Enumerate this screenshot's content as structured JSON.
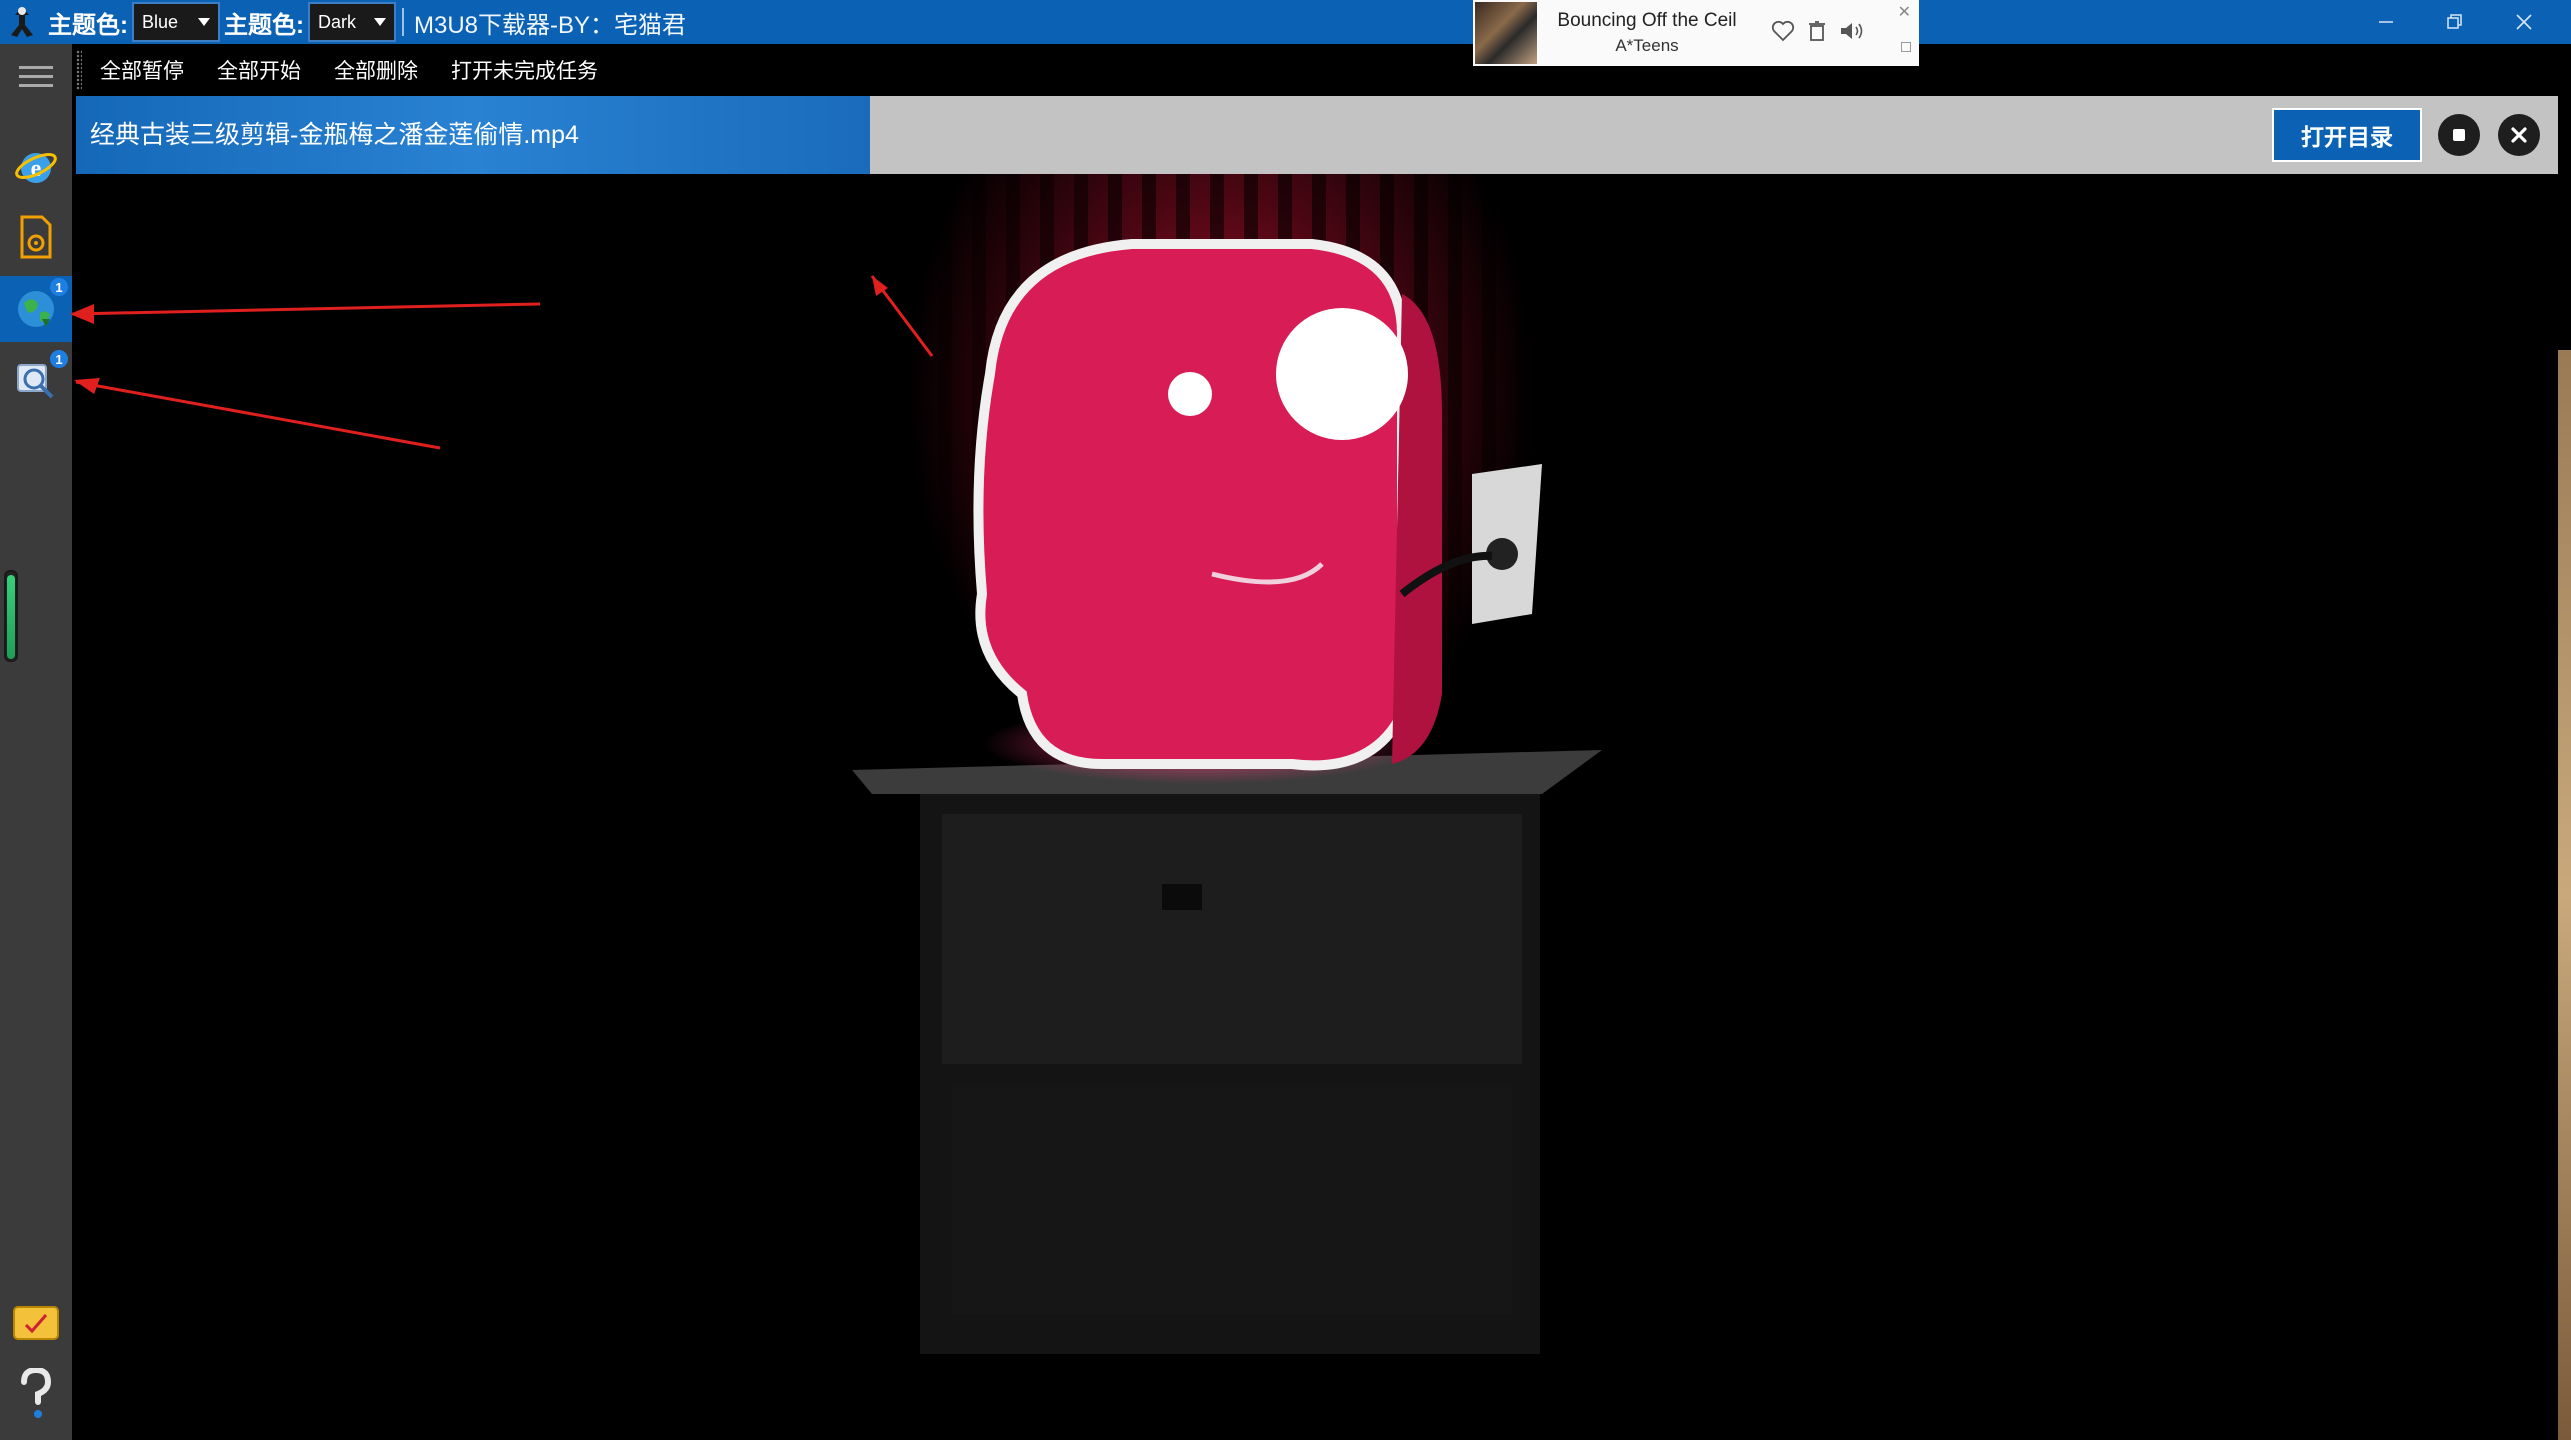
{
  "titlebar": {
    "theme_label_1": "主题色:",
    "theme_value_1": "Blue",
    "theme_label_2": "主题色:",
    "theme_value_2": "Dark",
    "app_title": "M3U8下载器-BY：宅猫君"
  },
  "player": {
    "song_title": "Bouncing Off the Ceil",
    "artist": "A*Teens"
  },
  "sidebar": {
    "items": [
      {
        "icon": "ie-browser-icon",
        "badge": ""
      },
      {
        "icon": "media-file-icon",
        "badge": ""
      },
      {
        "icon": "globe-download-icon",
        "badge": "1",
        "active": true
      },
      {
        "icon": "search-globe-icon",
        "badge": "1"
      }
    ],
    "progress_percent": 95
  },
  "toolbar": {
    "pause_all": "全部暂停",
    "start_all": "全部开始",
    "delete_all": "全部删除",
    "open_unfinished": "打开未完成任务"
  },
  "task": {
    "filename": "经典古装三级剪辑-金瓶梅之潘金莲偷情.mp4",
    "progress_percent": 32,
    "open_dir_label": "打开目录"
  },
  "colors": {
    "accent": "#0b62b4",
    "sidebar_bg": "#3b3b3b",
    "task_bg": "#c3c3c3",
    "arrow": "#e0201e"
  }
}
